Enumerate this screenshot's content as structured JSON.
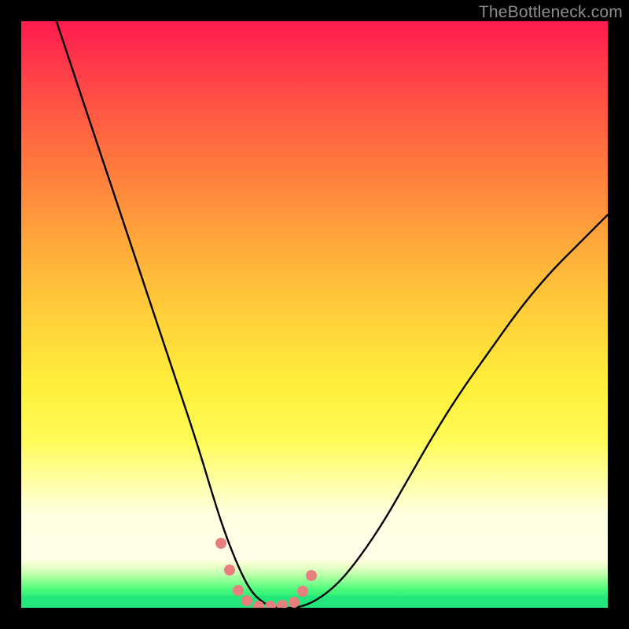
{
  "watermark": "TheBottleneck.com",
  "colors": {
    "frame": "#000000",
    "marker": "#e67f7d",
    "curve": "#000000",
    "green_base": "#23e77a"
  },
  "chart_data": {
    "type": "line",
    "title": "",
    "xlabel": "",
    "ylabel": "",
    "xlim": [
      0,
      100
    ],
    "ylim": [
      0,
      100
    ],
    "series": [
      {
        "name": "bottleneck-curve",
        "x": [
          6,
          10,
          14,
          18,
          22,
          26,
          30,
          33,
          35,
          37,
          39,
          41,
          43,
          45,
          47,
          50,
          54,
          58,
          62,
          66,
          70,
          75,
          80,
          85,
          90,
          95,
          100
        ],
        "y": [
          100,
          88,
          76,
          64,
          52,
          40,
          28,
          18,
          12,
          7,
          3,
          1,
          0,
          0,
          0,
          1,
          4,
          9,
          15,
          22,
          29,
          37,
          44,
          51,
          57,
          62,
          67
        ]
      }
    ],
    "markers": {
      "name": "optimal-range-dots",
      "x": [
        34.0,
        35.5,
        37.0,
        38.5,
        40.5,
        42.5,
        44.5,
        46.5,
        48.0,
        49.5
      ],
      "y": [
        11.0,
        6.5,
        3.0,
        1.2,
        0.3,
        0.3,
        0.4,
        1.0,
        2.8,
        5.5
      ]
    }
  }
}
